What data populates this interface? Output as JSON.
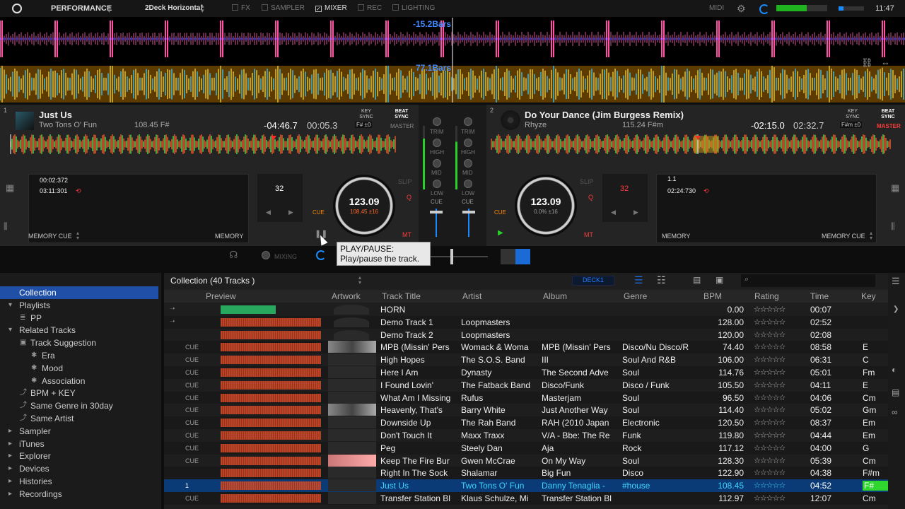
{
  "topbar": {
    "mode": "PERFORMANCE",
    "layout": "2Deck Horizontal",
    "checks": [
      {
        "label": "FX",
        "on": false
      },
      {
        "label": "SAMPLER",
        "on": false
      },
      {
        "label": "MIXER",
        "on": true
      },
      {
        "label": "REC",
        "on": false
      },
      {
        "label": "LIGHTING",
        "on": false
      }
    ],
    "midi": "MIDI",
    "clock": "11:47"
  },
  "overview": {
    "bars1": "-15.2Bars",
    "bars2": "77.1Bars"
  },
  "deck1": {
    "number": "1",
    "title": "Just Us",
    "artist": "Two Tons O' Fun",
    "bpm_key": "108.45 F#",
    "remain": "-04:46.7",
    "elapsed": "00:05.3",
    "key_sync": "KEY SYNC",
    "key_val": "F# ±0",
    "beat_sync": "BEAT SYNC",
    "master": "MASTER",
    "cue1": "00:02:372",
    "cue2": "03:11:301",
    "memory_cue": "MEMORY CUE",
    "memory": "MEMORY",
    "beat_count": "32",
    "jog_bpm": "123.09",
    "jog_sub": "108.45 ±16",
    "cue_btn": "CUE",
    "slip": "SLIP",
    "q": "Q",
    "mt": "MT"
  },
  "deck2": {
    "number": "2",
    "title": "Do Your Dance (Jim Burgess Remix)",
    "artist": "Rhyze",
    "bpm_key": "115.24 F#m",
    "remain": "-02:15.0",
    "elapsed": "02:32.7",
    "key_sync": "KEY SYNC",
    "key_val": "F#m ±0",
    "beat_sync": "BEAT SYNC",
    "master": "MASTER",
    "cue1": "1.1",
    "cue2": "02:24:730",
    "memory_cue": "MEMORY CUE",
    "memory": "MEMORY",
    "beat_count": "32",
    "jog_bpm": "123.09",
    "jog_sub": "0.0% ±16",
    "cue_btn": "CUE",
    "slip": "SLIP",
    "q": "Q",
    "mt": "MT"
  },
  "mixer": {
    "trim": "TRIM",
    "high": "HIGH",
    "mid": "MID",
    "low": "LOW",
    "cue": "CUE",
    "mixing": "MIXING"
  },
  "tooltip": {
    "line1": "PLAY/PAUSE:",
    "line2": "Play/pause the track."
  },
  "sidebar": {
    "items": [
      {
        "label": "Collection",
        "indent": 0,
        "selected": true,
        "icon": "none"
      },
      {
        "label": "Playlists",
        "indent": 0,
        "selected": false,
        "icon": "expand-icon"
      },
      {
        "label": "PP",
        "indent": 1,
        "selected": false,
        "icon": "playlist-icon"
      },
      {
        "label": "Related Tracks",
        "indent": 0,
        "selected": false,
        "icon": "expand-icon"
      },
      {
        "label": "Track Suggestion",
        "indent": 1,
        "selected": false,
        "icon": "folder-icon"
      },
      {
        "label": "Era",
        "indent": 2,
        "selected": false,
        "icon": "gear-icon"
      },
      {
        "label": "Mood",
        "indent": 2,
        "selected": false,
        "icon": "gear-icon"
      },
      {
        "label": "Association",
        "indent": 2,
        "selected": false,
        "icon": "gear-icon"
      },
      {
        "label": "BPM + KEY",
        "indent": 1,
        "selected": false,
        "icon": "link-icon"
      },
      {
        "label": "Same Genre in 30day",
        "indent": 1,
        "selected": false,
        "icon": "link-icon"
      },
      {
        "label": "Same Artist",
        "indent": 1,
        "selected": false,
        "icon": "link-icon"
      },
      {
        "label": "Sampler",
        "indent": 0,
        "selected": false,
        "icon": "collapse-icon"
      },
      {
        "label": "iTunes",
        "indent": 0,
        "selected": false,
        "icon": "collapse-icon"
      },
      {
        "label": "Explorer",
        "indent": 0,
        "selected": false,
        "icon": "collapse-icon"
      },
      {
        "label": "Devices",
        "indent": 0,
        "selected": false,
        "icon": "collapse-icon"
      },
      {
        "label": "Histories",
        "indent": 0,
        "selected": false,
        "icon": "collapse-icon"
      },
      {
        "label": "Recordings",
        "indent": 0,
        "selected": false,
        "icon": "collapse-icon"
      }
    ]
  },
  "browser": {
    "title": "Collection (40 Tracks )",
    "deck_select": "DECK1",
    "columns": {
      "preview": "Preview",
      "artwork": "Artwork",
      "title": "Track Title",
      "artist": "Artist",
      "album": "Album",
      "genre": "Genre",
      "bpm": "BPM",
      "rating": "Rating",
      "time": "Time",
      "key": "Key"
    },
    "rows": [
      {
        "mark": "",
        "title": "HORN",
        "artist": "",
        "album": "",
        "genre": "",
        "bpm": "0.00",
        "rating": "☆☆☆☆☆",
        "time": "00:07",
        "key": ""
      },
      {
        "mark": "",
        "title": "Demo Track 1",
        "artist": "Loopmasters",
        "album": "",
        "genre": "",
        "bpm": "128.00",
        "rating": "☆☆☆☆☆",
        "time": "02:52",
        "key": ""
      },
      {
        "mark": "",
        "title": "Demo Track 2",
        "artist": "Loopmasters",
        "album": "",
        "genre": "",
        "bpm": "120.00",
        "rating": "☆☆☆☆☆",
        "time": "02:08",
        "key": ""
      },
      {
        "mark": "CUE",
        "title": "MPB (Missin' Pers",
        "artist": "Womack & Woma",
        "album": "MPB (Missin' Pers",
        "genre": "Disco/Nu Disco/R",
        "bpm": "74.40",
        "rating": "☆☆☆☆☆",
        "time": "08:58",
        "key": "E"
      },
      {
        "mark": "CUE",
        "title": "High Hopes",
        "artist": "The S.O.S. Band",
        "album": "III",
        "genre": "Soul And R&B",
        "bpm": "106.00",
        "rating": "☆☆☆☆☆",
        "time": "06:31",
        "key": "C"
      },
      {
        "mark": "CUE",
        "title": "Here I Am",
        "artist": "Dynasty",
        "album": "The Second Adve",
        "genre": "Soul",
        "bpm": "114.76",
        "rating": "☆☆☆☆☆",
        "time": "05:01",
        "key": "Fm"
      },
      {
        "mark": "CUE",
        "title": "I Found Lovin'",
        "artist": "The Fatback Band",
        "album": "Disco/Funk",
        "genre": "Disco / Funk",
        "bpm": "105.50",
        "rating": "☆☆☆☆☆",
        "time": "04:11",
        "key": "E"
      },
      {
        "mark": "CUE",
        "title": "What Am I Missing",
        "artist": "Rufus",
        "album": "Masterjam",
        "genre": "Soul",
        "bpm": "96.50",
        "rating": "☆☆☆☆☆",
        "time": "04:06",
        "key": "Cm"
      },
      {
        "mark": "CUE",
        "title": "Heavenly, That's",
        "artist": "Barry White",
        "album": "Just Another Way",
        "genre": "Soul",
        "bpm": "114.40",
        "rating": "☆☆☆☆☆",
        "time": "05:02",
        "key": "Gm"
      },
      {
        "mark": "CUE",
        "title": "Downside Up",
        "artist": "The Rah Band",
        "album": "RAH (2010 Japan",
        "genre": "Electronic",
        "bpm": "120.50",
        "rating": "☆☆☆☆☆",
        "time": "08:37",
        "key": "Em"
      },
      {
        "mark": "CUE",
        "title": "Don't Touch It",
        "artist": "Maxx Traxx",
        "album": "V/A - Bbe: The Re",
        "genre": "Funk",
        "bpm": "119.80",
        "rating": "☆☆☆☆☆",
        "time": "04:44",
        "key": "Em"
      },
      {
        "mark": "CUE",
        "title": "Peg",
        "artist": "Steely Dan",
        "album": "Aja",
        "genre": "Rock",
        "bpm": "117.12",
        "rating": "☆☆☆☆☆",
        "time": "04:00",
        "key": "G"
      },
      {
        "mark": "CUE",
        "title": "Keep The Fire Bur",
        "artist": "Gwen McCrae",
        "album": "On My Way",
        "genre": "Soul",
        "bpm": "128.30",
        "rating": "☆☆☆☆☆",
        "time": "05:39",
        "key": "Cm"
      },
      {
        "mark": "",
        "title": "Right In The Sock",
        "artist": "Shalamar",
        "album": "Big Fun",
        "genre": "Disco",
        "bpm": "122.90",
        "rating": "☆☆☆☆☆",
        "time": "04:38",
        "key": "F#m"
      },
      {
        "mark": "1",
        "title": "Just Us",
        "artist": "Two Tons O' Fun",
        "album": "Danny Tenaglia -",
        "genre": "#house",
        "bpm": "108.45",
        "rating": "☆☆☆☆☆",
        "time": "04:52",
        "key": "F#"
      },
      {
        "mark": "CUE",
        "title": "Transfer Station Bl",
        "artist": "Klaus Schulze, Mi",
        "album": "Transfer Station Bl",
        "genre": "",
        "bpm": "112.97",
        "rating": "☆☆☆☆☆",
        "time": "12:07",
        "key": "Cm"
      }
    ]
  },
  "colors": {
    "accent": "#1f4fa6",
    "selected_row": "#0b3b77",
    "selected_text": "#3fd4ff",
    "master": "#ff3b3b",
    "key_highlight": "#2ed62e",
    "cue_orange": "#ff8a00"
  }
}
